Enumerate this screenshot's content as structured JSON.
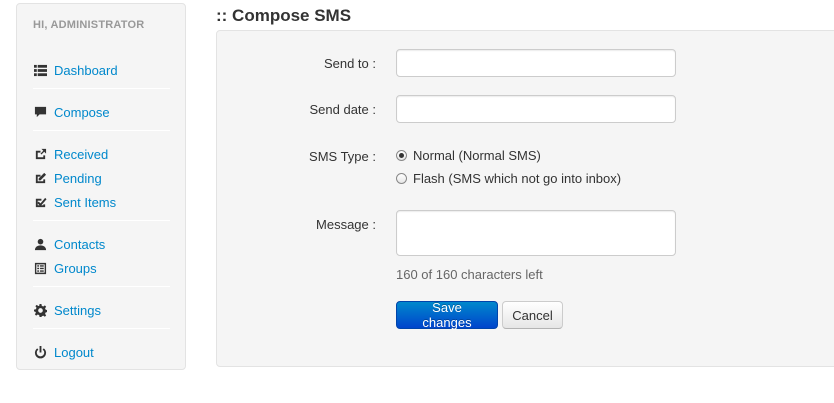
{
  "sidebar": {
    "header": "HI, ADMINISTRATOR",
    "items": [
      {
        "label": "Dashboard",
        "icon": "list-icon"
      },
      {
        "label": "Compose",
        "icon": "comment-icon"
      },
      {
        "label": "Received",
        "icon": "share-icon"
      },
      {
        "label": "Pending",
        "icon": "edit-icon"
      },
      {
        "label": "Sent Items",
        "icon": "check-icon"
      },
      {
        "label": "Contacts",
        "icon": "user-icon"
      },
      {
        "label": "Groups",
        "icon": "list-alt-icon"
      },
      {
        "label": "Settings",
        "icon": "cog-icon"
      },
      {
        "label": "Logout",
        "icon": "power-icon"
      }
    ]
  },
  "main": {
    "title": ":: Compose SMS",
    "form": {
      "send_to": {
        "label": "Send to :",
        "value": "",
        "placeholder": ""
      },
      "send_date": {
        "label": "Send date :",
        "value": "",
        "placeholder": ""
      },
      "sms_type": {
        "label": "SMS Type :",
        "options": [
          {
            "label": "Normal (Normal SMS)",
            "checked": true
          },
          {
            "label": "Flash (SMS which not go into inbox)",
            "checked": false
          }
        ]
      },
      "message": {
        "label": "Message :",
        "value": "",
        "placeholder": ""
      },
      "chars_left": "160 of 160 characters left",
      "save_label": "Save changes",
      "cancel_label": "Cancel"
    }
  },
  "colors": {
    "link": "#0088cc",
    "primary": "#0066cc",
    "panel": "#f5f5f5"
  }
}
